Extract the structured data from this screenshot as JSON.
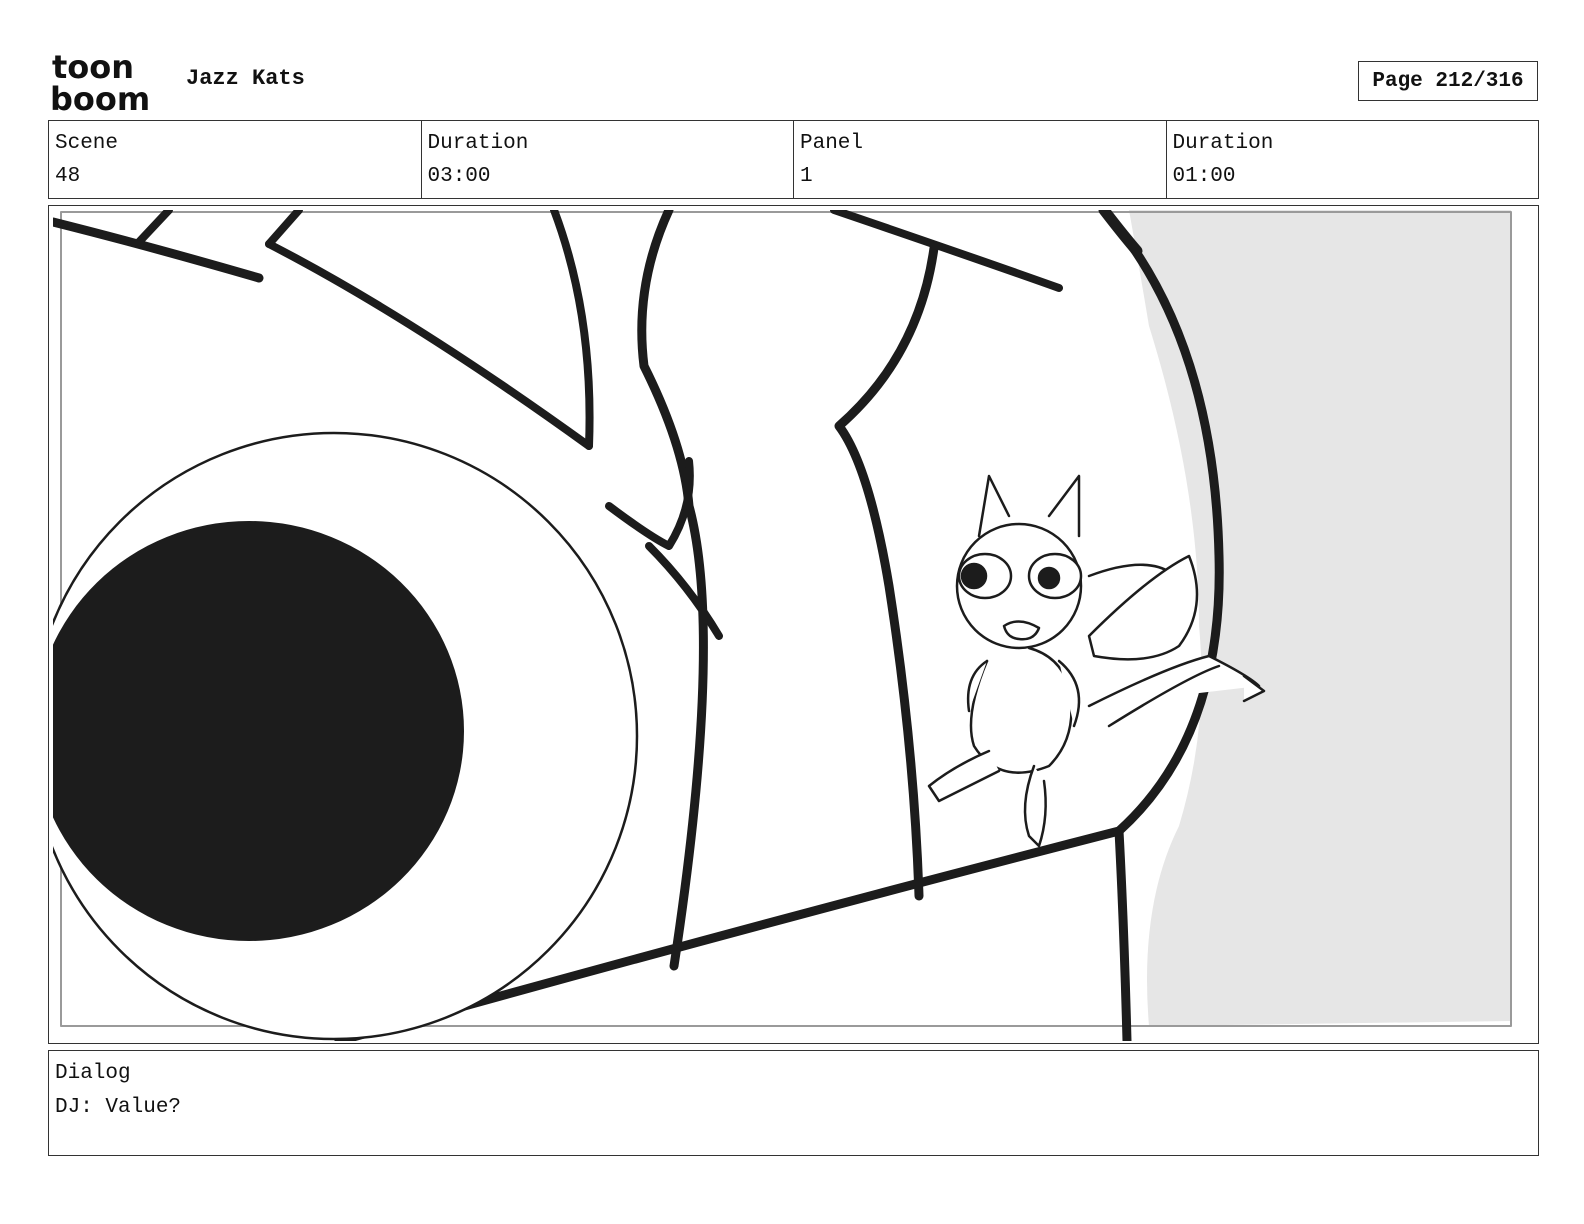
{
  "header": {
    "logo_line1": "toon",
    "logo_line2": "boom",
    "project_title": "Jazz Kats",
    "page_label": "Page 212/316"
  },
  "info": {
    "scene_label": "Scene",
    "scene_value": "48",
    "scene_duration_label": "Duration",
    "scene_duration_value": "03:00",
    "panel_label": "Panel",
    "panel_value": "1",
    "panel_duration_label": "Duration",
    "panel_duration_value": "01:00"
  },
  "dialog": {
    "label": "Dialog",
    "text": "DJ: Value?"
  },
  "colors": {
    "ink": "#1c1c1c",
    "shadow_area": "#e6e6e6",
    "border": "#333333"
  }
}
